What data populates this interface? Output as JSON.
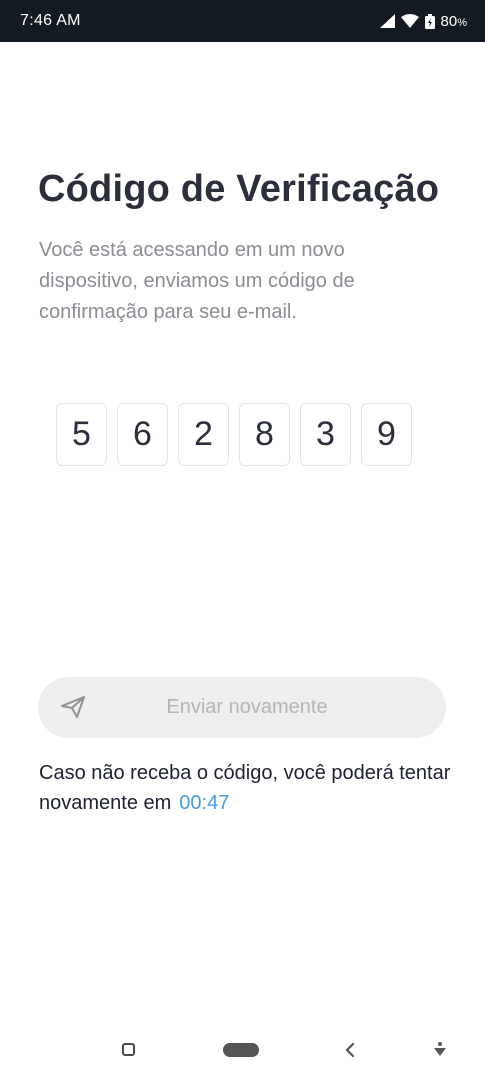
{
  "status_bar": {
    "time": "7:46 AM",
    "battery": "80",
    "battery_unit": "%",
    "icons": [
      "signal-icon",
      "wifi-icon",
      "battery-icon"
    ]
  },
  "page": {
    "title": "Código de Verificação",
    "subtitle": "Você está acessando em um novo dispositivo, enviamos um código de confirmação para seu e-mail."
  },
  "code": {
    "digits": [
      "5",
      "6",
      "2",
      "8",
      "3",
      "9"
    ]
  },
  "resend": {
    "label": "Enviar novamente",
    "icon": "send-icon"
  },
  "info": {
    "text": "Caso não receba o código, você poderá tentar novamente em",
    "timer": "00:47"
  },
  "colors": {
    "status_bar_bg": "#141a22",
    "title": "#2a2f3b",
    "subtitle": "#8a8d93",
    "timer": "#4a9be0",
    "button_bg": "#eeeeee",
    "button_text": "#b3b5b9"
  },
  "nav_bar": {
    "icons": [
      "recents-icon",
      "home-icon",
      "back-icon",
      "down-icon"
    ]
  }
}
